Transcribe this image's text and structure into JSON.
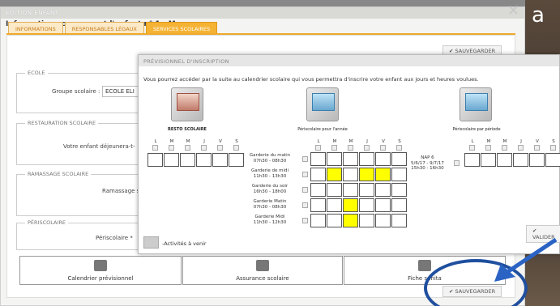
{
  "window": {
    "title": "EDITION ENFANT",
    "subtitle": "Informations concernant l'enfant n° 1 : Marc",
    "close_glyph": "✕"
  },
  "background_letter": "a",
  "tabs": [
    {
      "label": "INFORMATIONS",
      "active": false
    },
    {
      "label": "RESPONSABLES LÉGAUX",
      "active": false
    },
    {
      "label": "SERVICES SCOLAIRES",
      "active": true
    }
  ],
  "save_label": "SAUVEGARDER",
  "sections": {
    "ecole": {
      "legend": "ECOLE",
      "label": "Groupe scolaire :",
      "value": "ECOLE ELI"
    },
    "restauration": {
      "legend": "RESTAURATION SCOLAIRE",
      "label": "Votre enfant déjeunera-t-"
    },
    "ramassage": {
      "legend": "RAMASSAGE SCOLAIRE",
      "label": "Ramassage s"
    },
    "periscolaire": {
      "legend": "PÉRISCOLAIRE",
      "label": "Périscolaire *"
    }
  },
  "bottom_buttons": {
    "calendrier": "Calendrier prévisionnel",
    "assurance": "Assurance scolaire",
    "fiche": "Fiche sanita"
  },
  "dialog": {
    "title": "PRÉVISIONNEL D'INSCRIPTION",
    "description": "Vous pourrez accéder par la suite au calendrier scolaire qui vous permettra d'inscrire votre enfant aux jours et heures voulues.",
    "services": [
      {
        "label": "RESTO SCOLAIRE"
      },
      {
        "label": "Périscolaire pour l'année"
      },
      {
        "label": "Périscolaire par période"
      }
    ],
    "days": [
      "L",
      "M",
      "M",
      "J",
      "V",
      "S"
    ],
    "resto_row": [
      false,
      false,
      false,
      false,
      false,
      false
    ],
    "periscolaire_rows": [
      {
        "label": "Garderie du matin",
        "time": "07h30 - 08h30",
        "cells": [
          false,
          false,
          false,
          false,
          false,
          false
        ]
      },
      {
        "label": "Garderie de midi",
        "time": "11h30 - 13h30",
        "cells": [
          false,
          true,
          false,
          true,
          true,
          false
        ]
      },
      {
        "label": "Garderie du soir",
        "time": "16h30 - 18h00",
        "cells": [
          false,
          false,
          false,
          false,
          false,
          false
        ]
      },
      {
        "label": "Garderie Matin",
        "time": "07h30 - 08h30",
        "cells": [
          false,
          false,
          true,
          false,
          false,
          false
        ]
      },
      {
        "label": "Garderie Midi",
        "time": "11h30 - 12h30",
        "cells": [
          false,
          false,
          true,
          false,
          false,
          false
        ]
      }
    ],
    "nap": {
      "label": "NAP 6",
      "dates": "5/6/17 - 9/7/17",
      "time": "15h30 - 16h30"
    },
    "legend": "-Activités à venir",
    "valider_label": "VALIDER"
  },
  "colors": {
    "tab_active": "#f5b335",
    "highlight": "#ffff00",
    "annotation": "#1f4f9e"
  }
}
